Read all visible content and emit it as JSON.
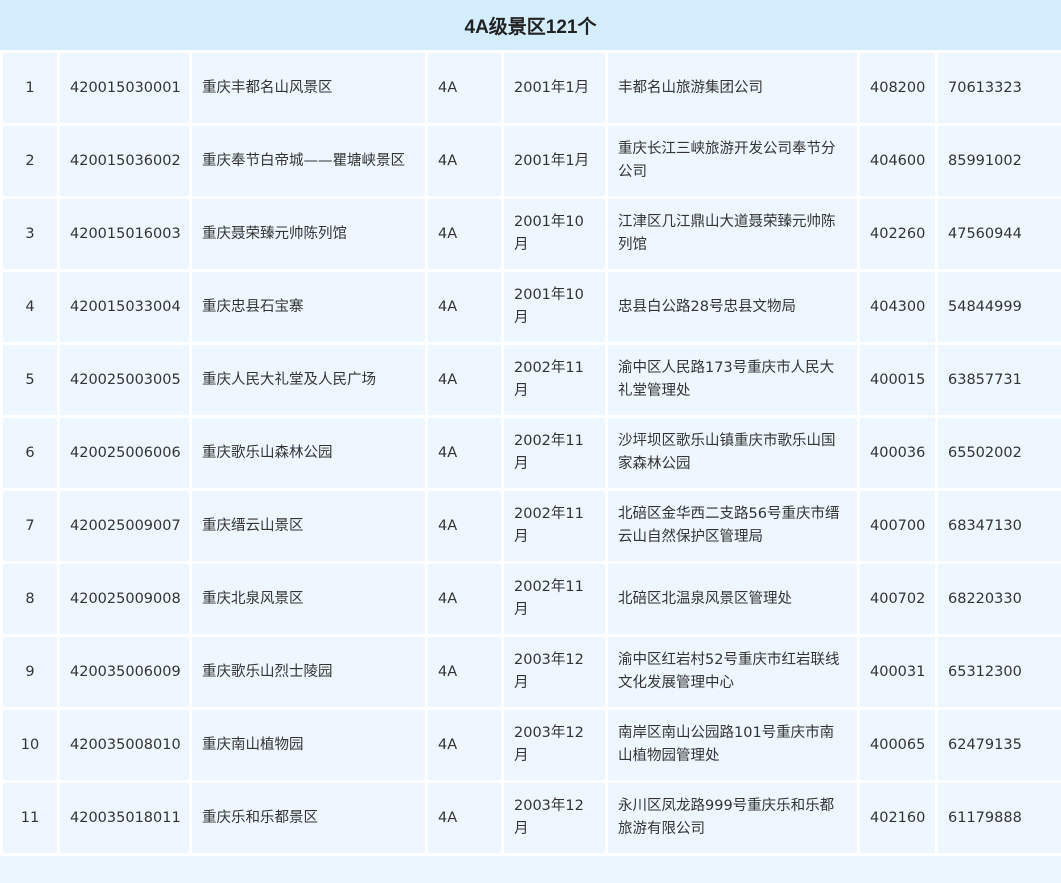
{
  "title": "4A级景区121个",
  "rows": [
    {
      "idx": "1",
      "code": "420015030001",
      "name": "重庆丰都名山风景区",
      "level": "4A",
      "date": "2001年1月",
      "unit": "丰都名山旅游集团公司",
      "postcode": "408200",
      "phone": "70613323"
    },
    {
      "idx": "2",
      "code": "420015036002",
      "name": "重庆奉节白帝城——瞿塘峡景区",
      "level": "4A",
      "date": "2001年1月",
      "unit": "重庆长江三峡旅游开发公司奉节分公司",
      "postcode": "404600",
      "phone": "85991002"
    },
    {
      "idx": "3",
      "code": "420015016003",
      "name": "重庆聂荣臻元帅陈列馆",
      "level": "4A",
      "date": "2001年10月",
      "unit": "江津区几江鼎山大道聂荣臻元帅陈列馆",
      "postcode": "402260",
      "phone": "47560944"
    },
    {
      "idx": "4",
      "code": "420015033004",
      "name": "重庆忠县石宝寨",
      "level": "4A",
      "date": "2001年10月",
      "unit": "忠县白公路28号忠县文物局",
      "postcode": "404300",
      "phone": "54844999"
    },
    {
      "idx": "5",
      "code": "420025003005",
      "name": "重庆人民大礼堂及人民广场",
      "level": "4A",
      "date": "2002年11月",
      "unit": "渝中区人民路173号重庆市人民大礼堂管理处",
      "postcode": "400015",
      "phone": "63857731"
    },
    {
      "idx": "6",
      "code": "420025006006",
      "name": "重庆歌乐山森林公园",
      "level": "4A",
      "date": "2002年11月",
      "unit": "沙坪坝区歌乐山镇重庆市歌乐山国家森林公园",
      "postcode": "400036",
      "phone": "65502002"
    },
    {
      "idx": "7",
      "code": "420025009007",
      "name": "重庆缙云山景区",
      "level": "4A",
      "date": "2002年11月",
      "unit": "北碚区金华西二支路56号重庆市缙云山自然保护区管理局",
      "postcode": "400700",
      "phone": "68347130"
    },
    {
      "idx": "8",
      "code": "420025009008",
      "name": "重庆北泉风景区",
      "level": "4A",
      "date": "2002年11月",
      "unit": "北碚区北温泉风景区管理处",
      "postcode": "400702",
      "phone": "68220330"
    },
    {
      "idx": "9",
      "code": "420035006009",
      "name": "重庆歌乐山烈士陵园",
      "level": "4A",
      "date": "2003年12月",
      "unit": "渝中区红岩村52号重庆市红岩联线文化发展管理中心",
      "postcode": "400031",
      "phone": "65312300"
    },
    {
      "idx": "10",
      "code": "420035008010",
      "name": "重庆南山植物园",
      "level": "4A",
      "date": "2003年12月",
      "unit": "南岸区南山公园路101号重庆市南山植物园管理处",
      "postcode": "400065",
      "phone": "62479135"
    },
    {
      "idx": "11",
      "code": "420035018011",
      "name": "重庆乐和乐都景区",
      "level": "4A",
      "date": "2003年12月",
      "unit": "永川区凤龙路999号重庆乐和乐都旅游有限公司",
      "postcode": "402160",
      "phone": "61179888"
    }
  ]
}
